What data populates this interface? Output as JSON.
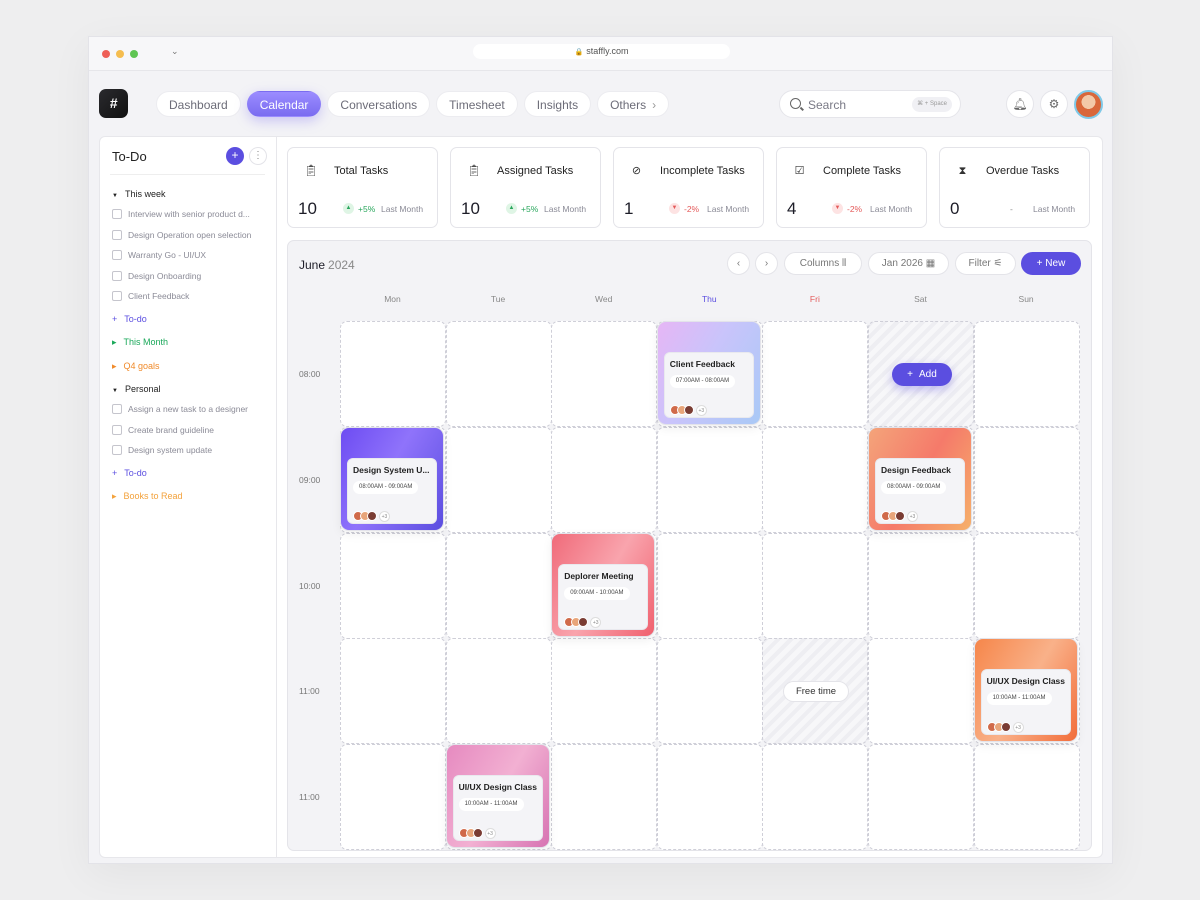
{
  "browser": {
    "url": "staffly.com"
  },
  "app": {
    "logo_text": "#"
  },
  "nav": {
    "items": [
      {
        "label": "Dashboard",
        "active": false
      },
      {
        "label": "Calendar",
        "active": true
      },
      {
        "label": "Conversations",
        "active": false
      },
      {
        "label": "Timesheet",
        "active": false
      },
      {
        "label": "Insights",
        "active": false
      },
      {
        "label": "Others",
        "active": false
      }
    ]
  },
  "search": {
    "placeholder": "Search",
    "shortcut": "⌘ + Space"
  },
  "sidebar": {
    "title": "To-Do",
    "sections": [
      {
        "label": "This week",
        "tasks": [
          "Interview with senior product d...",
          "Design Operation open selection",
          "Warranty Go - UI/UX",
          "Design Onboarding",
          "Client Feedback"
        ]
      },
      {
        "label": "Personal",
        "tasks": [
          "Assign a new task to a designer",
          "Create brand guideline",
          "Design system update"
        ]
      }
    ],
    "links_a": [
      {
        "prefix": "+",
        "label": "To-do",
        "color": "purple"
      },
      {
        "prefix": "▸",
        "label": "This Month",
        "color": "green"
      },
      {
        "prefix": "▸",
        "label": "Q4 goals",
        "color": "orange"
      }
    ],
    "links_b": [
      {
        "prefix": "+",
        "label": "To-do",
        "color": "purple"
      },
      {
        "prefix": "▸",
        "label": "Books to Read",
        "color": "amber"
      }
    ]
  },
  "stats": [
    {
      "title": "Total Tasks",
      "value": "10",
      "change": "+5%",
      "trend": "up",
      "note": "Last Month",
      "icon": "clipboard-icon"
    },
    {
      "title": "Assigned Tasks",
      "value": "10",
      "change": "+5%",
      "trend": "up",
      "note": "Last Month",
      "icon": "clipboard-user-icon"
    },
    {
      "title": "Incomplete Tasks",
      "value": "1",
      "change": "-2%",
      "trend": "down",
      "note": "Last Month",
      "icon": "no-entry-icon"
    },
    {
      "title": "Complete Tasks",
      "value": "4",
      "change": "-2%",
      "trend": "down",
      "note": "Last Month",
      "icon": "clipboard-check-icon"
    },
    {
      "title": "Overdue Tasks",
      "value": "0",
      "change": "-",
      "trend": "flat",
      "note": "Last Month",
      "icon": "hourglass-icon"
    }
  ],
  "calendar": {
    "month": "June",
    "year": "2024",
    "controls": {
      "columns": "Columns",
      "date": "Jan 2026",
      "filter": "Filter",
      "new": "New"
    },
    "days": [
      {
        "label": "Mon",
        "color": "#888888"
      },
      {
        "label": "Tue",
        "color": "#888888"
      },
      {
        "label": "Wed",
        "color": "#888888"
      },
      {
        "label": "Thu",
        "color": "#5b4ee0"
      },
      {
        "label": "Fri",
        "color": "#e45a5a"
      },
      {
        "label": "Sat",
        "color": "#888888"
      },
      {
        "label": "Sun",
        "color": "#888888"
      }
    ],
    "times": [
      "08:00",
      "09:00",
      "10:00",
      "11:00",
      "11:00"
    ],
    "add_label": "Add",
    "free_label": "Free time",
    "events": [
      {
        "title": "Client Feedback",
        "time": "07:00AM - 08:00AM",
        "extra": "+3",
        "day": 3,
        "row": 0,
        "gradient": "linear-gradient(120deg,#e6b6f5 0%,#c9c4fb 45%,#a9c9f6 100%)"
      },
      {
        "title": "Design System U...",
        "time": "08:00AM - 09:00AM",
        "extra": "+3",
        "day": 0,
        "row": 1,
        "gradient": "linear-gradient(120deg,#6d4cf2 0%,#8f73fb 45%,#5b4ee0 100%)"
      },
      {
        "title": "Design Feedback",
        "time": "08:00AM - 09:00AM",
        "extra": "+3",
        "day": 5,
        "row": 1,
        "gradient": "linear-gradient(120deg,#f4a47a 0%,#f57a6a 50%,#f6b06a 100%)"
      },
      {
        "title": "Deplorer Meeting",
        "time": "09:00AM - 10:00AM",
        "extra": "+3",
        "day": 2,
        "row": 2,
        "gradient": "linear-gradient(120deg,#f06b7a 0%,#f9a4ad 50%,#f0606e 100%)"
      },
      {
        "title": "UI/UX Design Class",
        "time": "10:00AM - 11:00AM",
        "extra": "+3",
        "day": 6,
        "row": 3,
        "gradient": "linear-gradient(120deg,#f6864a 0%,#f9b189 50%,#f26d3a 100%)"
      },
      {
        "title": "UI/UX Design Class",
        "time": "10:00AM - 11:00AM",
        "extra": "+3",
        "day": 1,
        "row": 4,
        "gradient": "linear-gradient(120deg,#e68ac0 0%,#f2b0d2 50%,#d773b2 100%)"
      }
    ]
  }
}
